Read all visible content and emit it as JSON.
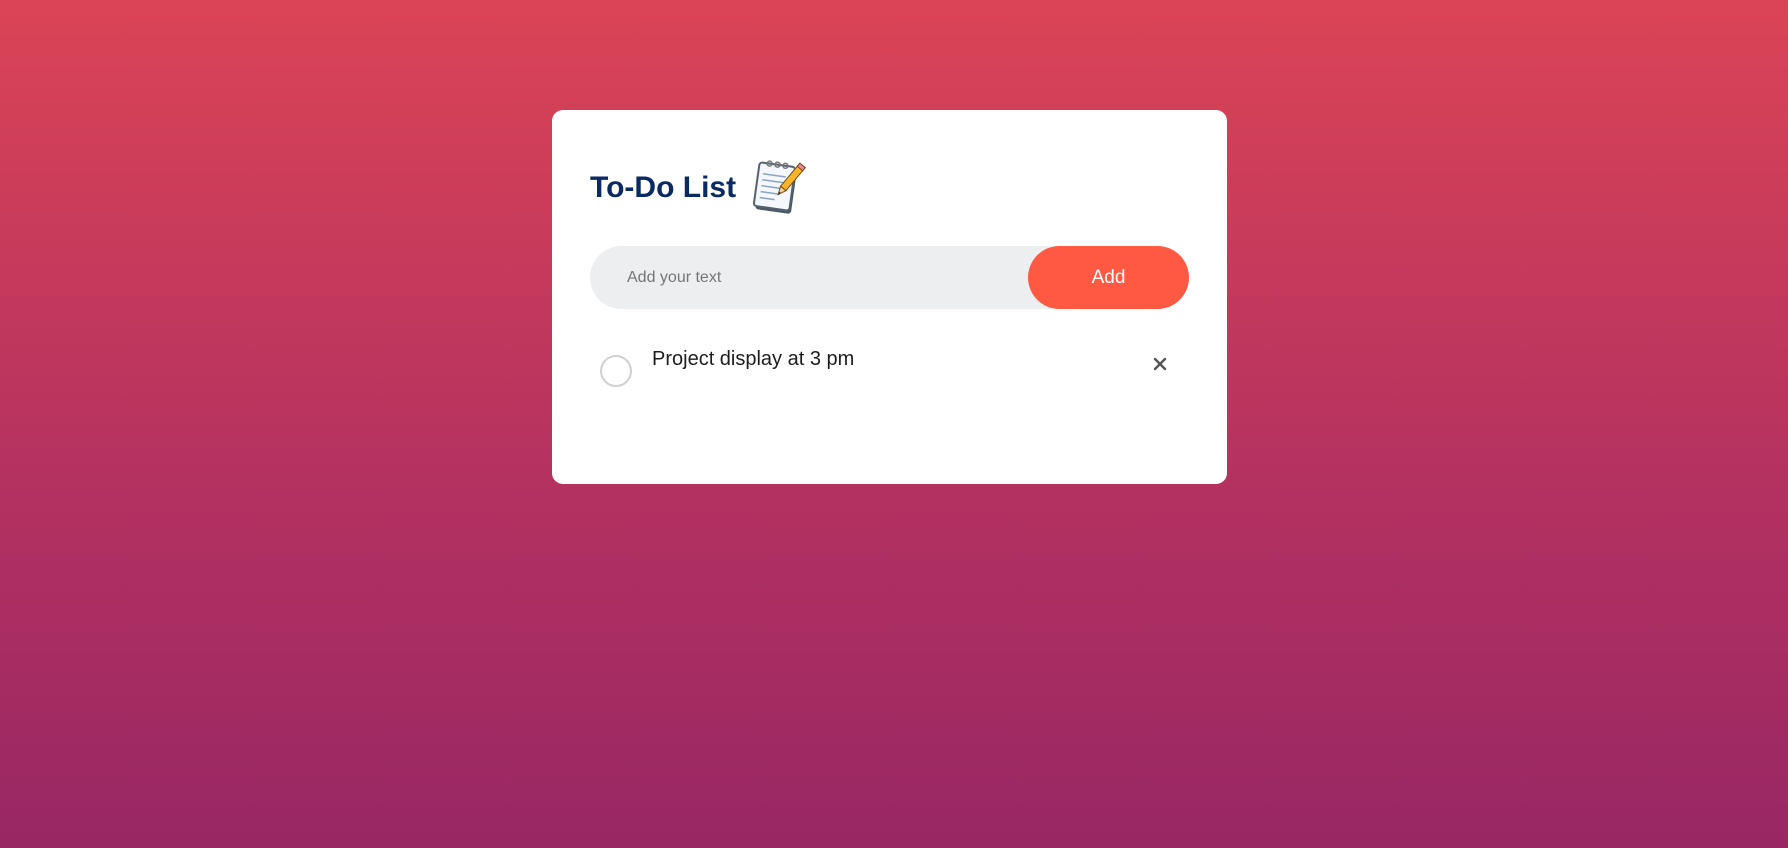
{
  "app": {
    "title": "To-Do List",
    "title_icon": "notepad-pencil-icon"
  },
  "input": {
    "placeholder": "Add your text",
    "value": ""
  },
  "add_button": {
    "label": "Add",
    "color": "#ff5944"
  },
  "tasks": [
    {
      "text": "Project display at 3 pm",
      "checked": false,
      "check_icon": "unchecked-circle-icon",
      "delete_icon": "close-icon"
    }
  ],
  "colors": {
    "background_top": "#db4456",
    "background_bottom": "#982764",
    "title": "#0b2a62",
    "input_bg": "#edeef0"
  }
}
